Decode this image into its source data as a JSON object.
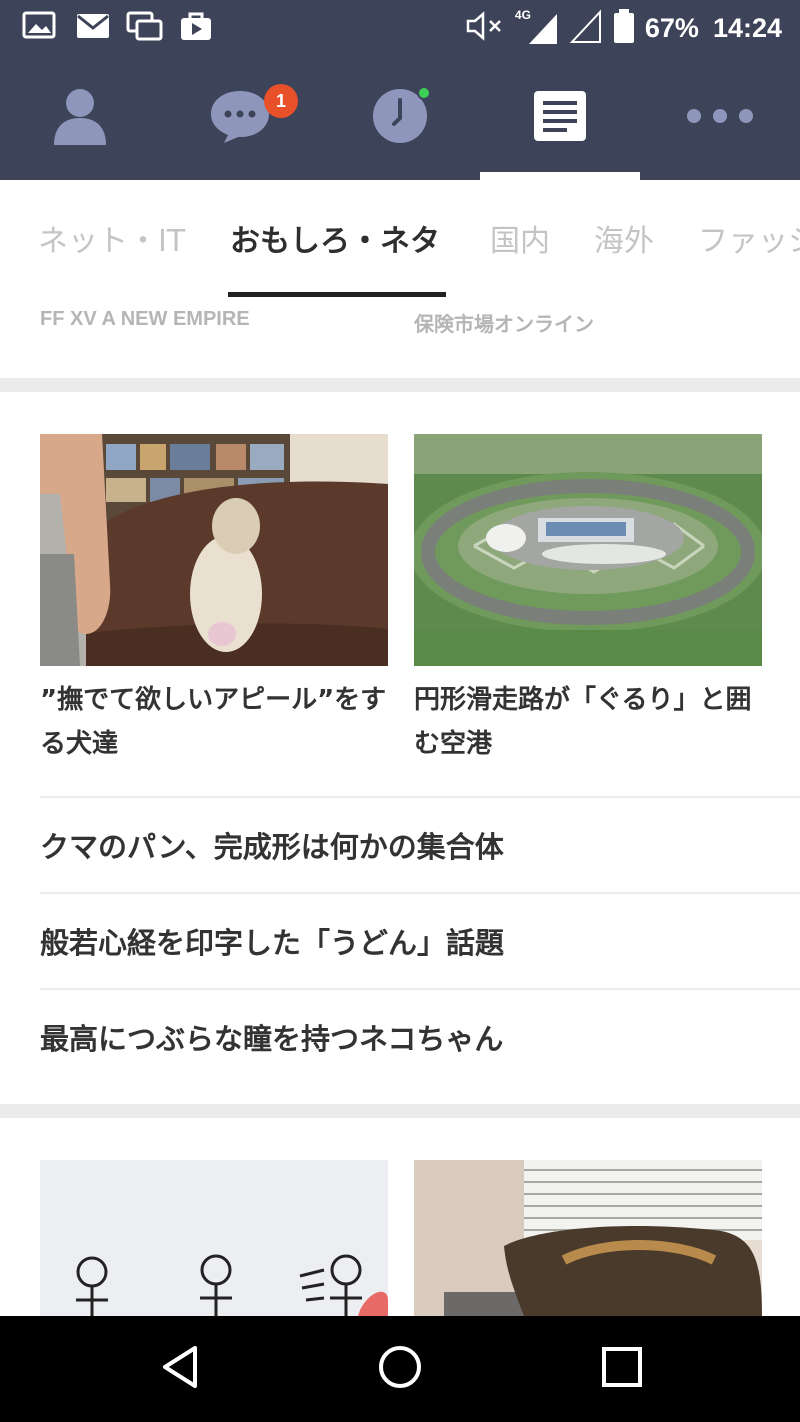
{
  "status_bar": {
    "battery_percent": "67%",
    "time": "14:24",
    "network_label": "4G",
    "left_icons": [
      "image-notification-icon",
      "gmail-icon",
      "chat-notification-icon",
      "store-icon"
    ],
    "right_icons": [
      "muted-icon",
      "signal-icon",
      "signal-empty-icon",
      "battery-icon"
    ],
    "colors": {
      "background": "#3d4358"
    }
  },
  "app_nav": {
    "items": [
      {
        "name": "friends",
        "icon": "person-icon"
      },
      {
        "name": "chats",
        "icon": "chat-bubble-icon",
        "badge": "1"
      },
      {
        "name": "timeline",
        "icon": "clock-icon",
        "has_dot": true
      },
      {
        "name": "news",
        "icon": "news-icon",
        "active": true
      },
      {
        "name": "more",
        "icon": "more-icon"
      }
    ],
    "colors": {
      "badge": "#e8502a",
      "dot": "#3dcf55"
    }
  },
  "tabs": {
    "items": [
      "ネット・IT",
      "おもしろ・ネタ",
      "国内",
      "海外",
      "ファッシ"
    ],
    "active_index": 1
  },
  "sources": {
    "left": "FF XV A NEW EMPIRE",
    "right": "保険市場オンライン"
  },
  "featured": [
    {
      "title": "”撫でて欲しいアピール”をする犬達",
      "image": "dog-on-sofa-photo"
    },
    {
      "title": "円形滑走路が「ぐるり」と囲む空港",
      "image": "circular-runway-airport-render"
    }
  ],
  "headlines": [
    "クマのパン、完成形は何かの集合体",
    "般若心経を印字した「うどん」話題",
    "最高につぶらな瞳を持つネコちゃん"
  ],
  "bottom_cards": [
    {
      "image": "stick-figures-illustration"
    },
    {
      "image": "cat-in-room-photo"
    }
  ],
  "system_nav": {
    "buttons": [
      "back-icon",
      "home-icon",
      "recents-icon"
    ]
  }
}
